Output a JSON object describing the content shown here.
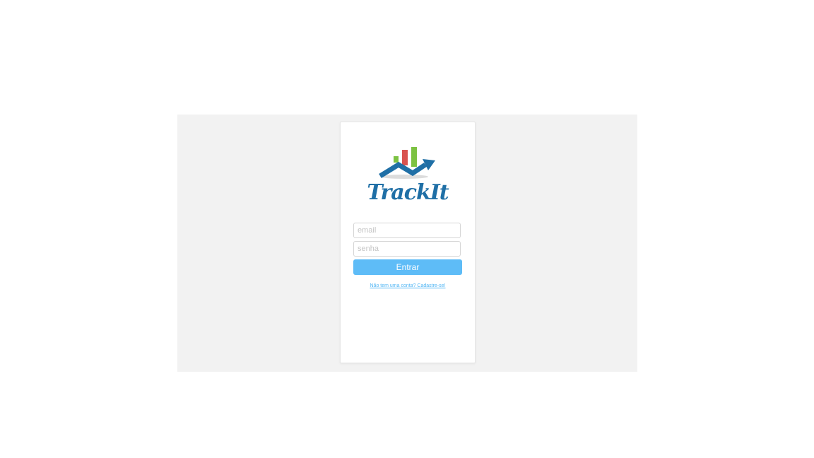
{
  "brand": {
    "name": "TrackIt",
    "logo_icon": "chart-arrow-logo-icon",
    "colors": {
      "blue": "#1f6fa6",
      "green": "#7cc242",
      "red": "#d9534f",
      "gray": "#d9d9d9"
    }
  },
  "login": {
    "email_placeholder": "email",
    "password_placeholder": "senha",
    "submit_label": "Entrar",
    "signup_link": "Não tem uma conta? Cadastre-se!",
    "accent_color": "#5ebcf7"
  }
}
